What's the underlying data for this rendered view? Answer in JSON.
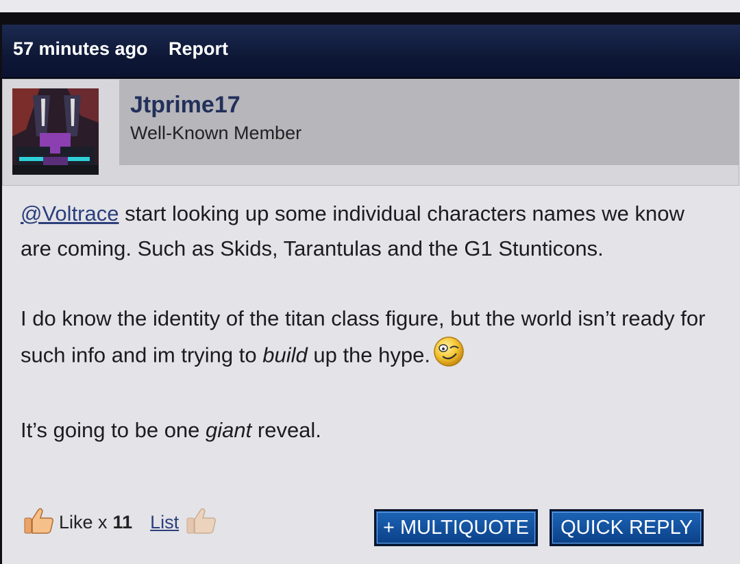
{
  "post_header": {
    "time": "57 minutes ago",
    "report": "Report"
  },
  "author": {
    "name": "Jtprime17",
    "title": "Well-Known Member"
  },
  "post": {
    "mention": "@Voltrace",
    "p1_rest": " start looking up some individual characters names we know are coming. Such as Skids, Tarantulas and the G1 Stunticons.",
    "p2_a": "I do know the identity of the titan class figure, but the world isn’t ready for such info and im trying to ",
    "p2_em": "build",
    "p2_b": " up the hype.",
    "p3_a": "It’s going to be one ",
    "p3_em": "giant",
    "p3_b": " reveal."
  },
  "reactions": {
    "like_label": "Like x",
    "like_count": "11",
    "list_label": "List"
  },
  "buttons": {
    "multiquote": "+ MULTIQUOTE",
    "quick_reply": "QUICK REPLY"
  },
  "colors": {
    "header_bg": "#0e1836",
    "link": "#2b3f7a",
    "button": "#0a4fa0"
  },
  "icons": [
    "thumbs-up-icon",
    "wink-emoji-icon"
  ]
}
